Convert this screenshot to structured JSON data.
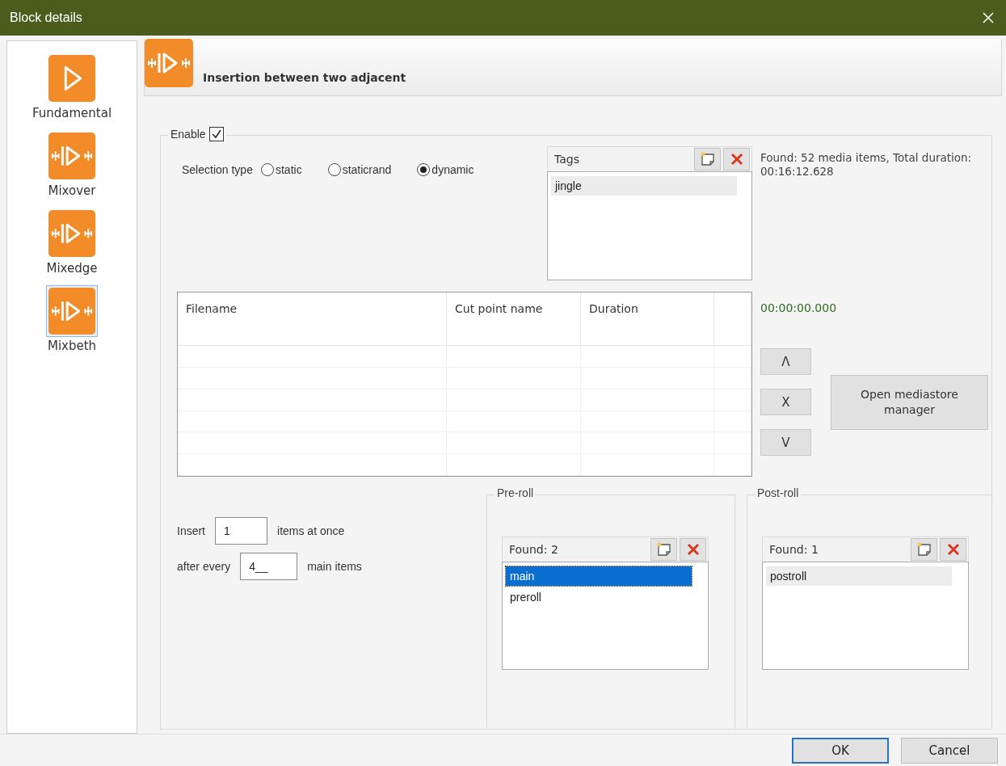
{
  "window": {
    "title": "Block details"
  },
  "sidebar": {
    "items": [
      {
        "label": "Fundamental",
        "kind": "play",
        "selected": false
      },
      {
        "label": "Mixover",
        "kind": "mix",
        "selected": false
      },
      {
        "label": "Mixedge",
        "kind": "mix",
        "selected": false
      },
      {
        "label": "Mixbeth",
        "kind": "mix",
        "selected": true
      }
    ]
  },
  "header": {
    "title": "Insertion between two adjacent",
    "kind": "mix"
  },
  "enable": {
    "label": "Enable",
    "checked": true
  },
  "selection_type": {
    "label": "Selection type",
    "options": [
      {
        "label": "static",
        "selected": false
      },
      {
        "label": "staticrand",
        "selected": false
      },
      {
        "label": "dynamic",
        "selected": true
      }
    ]
  },
  "tags": {
    "title": "Tags",
    "focused": false,
    "items": [
      {
        "label": "jingle",
        "selected": true
      }
    ]
  },
  "found_summary": "Found: 52 media items, Total duration: 00:16:12.628",
  "table": {
    "columns": [
      "Filename",
      "Cut point name",
      "Duration"
    ]
  },
  "total_duration": "00:00:00.000",
  "move_buttons": [
    "Λ",
    "X",
    "V"
  ],
  "open_button": "Open mediastore manager",
  "insert": {
    "label": "Insert",
    "value": "1",
    "suffix": "items at once"
  },
  "after_every": {
    "label": "after every",
    "value": "4__",
    "suffix": "main items"
  },
  "preroll": {
    "title": "Pre-roll",
    "found": "Found: 2",
    "focused": true,
    "items": [
      {
        "label": "main",
        "selected": true
      },
      {
        "label": "preroll",
        "selected": false
      }
    ]
  },
  "postroll": {
    "title": "Post-roll",
    "found": "Found: 1",
    "focused": false,
    "items": [
      {
        "label": "postroll",
        "selected": true
      }
    ]
  },
  "buttons": [
    {
      "label": "OK",
      "default": true
    },
    {
      "label": "Cancel",
      "default": false
    }
  ]
}
